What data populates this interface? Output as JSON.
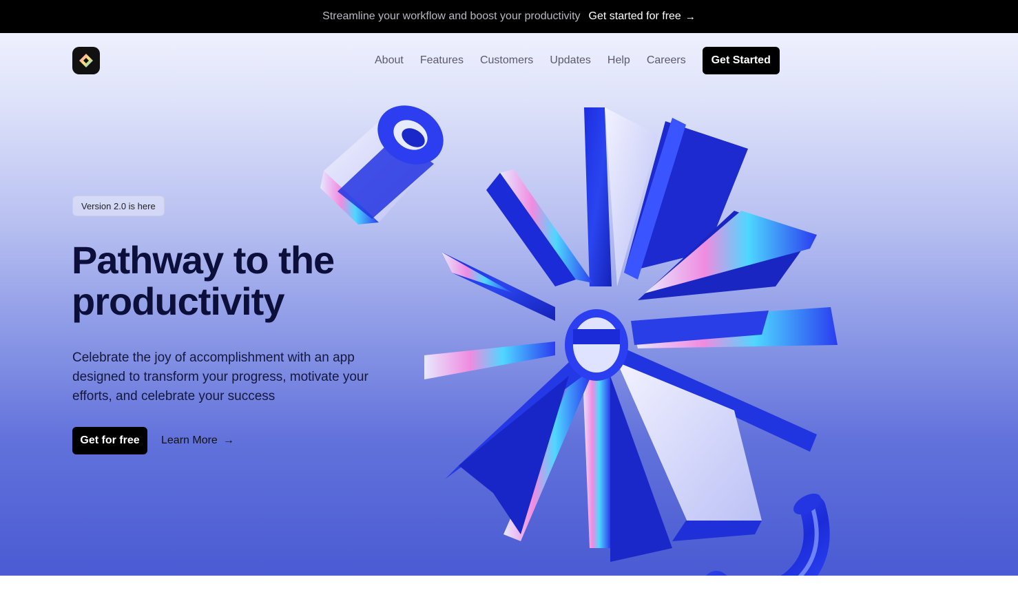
{
  "announcement": {
    "text": "Streamline your workflow and boost your productivity",
    "link_label": "Get started for free",
    "link_arrow": "→"
  },
  "nav": {
    "items": [
      {
        "label": "About"
      },
      {
        "label": "Features"
      },
      {
        "label": "Customers"
      },
      {
        "label": "Updates"
      },
      {
        "label": "Help"
      },
      {
        "label": "Careers"
      }
    ],
    "cta_label": "Get Started"
  },
  "hero": {
    "badge": "Version 2.0 is here",
    "title_line1": "Pathway to the",
    "title_line2": "productivity",
    "description": "Celebrate the joy of accomplishment with an app designed to transform your progress, motivate your efforts, and celebrate your success",
    "primary_cta": "Get for free",
    "secondary_cta": "Learn More",
    "secondary_arrow": "→"
  },
  "colors": {
    "accent": "#1f2fd6",
    "dark": "#000000",
    "title": "#0b0f3a"
  }
}
